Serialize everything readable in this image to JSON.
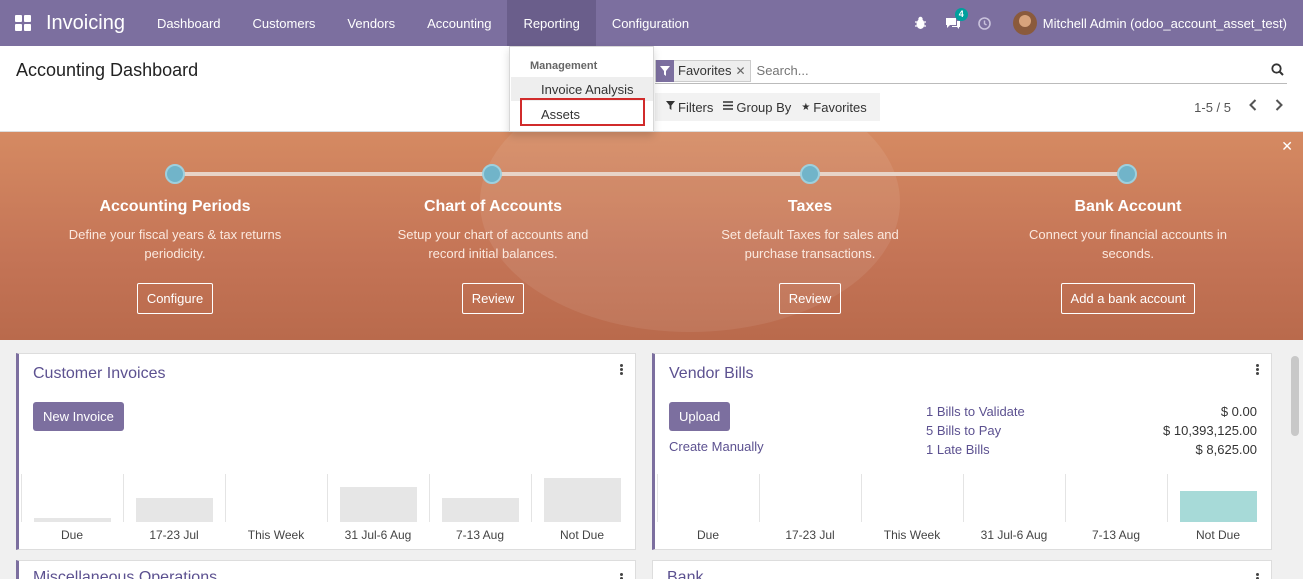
{
  "app": {
    "title": "Invoicing"
  },
  "nav": {
    "items": [
      {
        "label": "Dashboard"
      },
      {
        "label": "Customers"
      },
      {
        "label": "Vendors"
      },
      {
        "label": "Accounting"
      },
      {
        "label": "Reporting"
      },
      {
        "label": "Configuration"
      }
    ],
    "active": "Reporting",
    "chat_badge": "4",
    "user": "Mitchell Admin (odoo_account_asset_test)",
    "icons": [
      "bug-icon",
      "chat-icon",
      "clock-icon"
    ]
  },
  "control": {
    "title": "Accounting Dashboard",
    "facet_label": "Favorites",
    "search_placeholder": "Search...",
    "filters_label": "Filters",
    "groupby_label": "Group By",
    "favorites_label": "Favorites",
    "pager": "1-5 / 5"
  },
  "dropdown": {
    "header": "Management",
    "items": [
      {
        "label": "Invoice Analysis"
      },
      {
        "label": "Assets"
      }
    ],
    "highlighted": "Assets"
  },
  "banner": {
    "steps": [
      {
        "title": "Accounting Periods",
        "desc": "Define your fiscal years & tax returns periodicity.",
        "button": "Configure"
      },
      {
        "title": "Chart of Accounts",
        "desc": "Setup your chart of accounts and record initial balances.",
        "button": "Review"
      },
      {
        "title": "Taxes",
        "desc": "Set default Taxes for sales and purchase transactions.",
        "button": "Review"
      },
      {
        "title": "Bank Account",
        "desc": "Connect your financial accounts in seconds.",
        "button": "Add a bank account"
      }
    ]
  },
  "cards": {
    "customer_invoices": {
      "title": "Customer Invoices",
      "primary_button": "New Invoice",
      "chart_labels": [
        "Due",
        "17-23 Jul",
        "This Week",
        "31 Jul-6 Aug",
        "7-13 Aug",
        "Not Due"
      ],
      "chart_values": [
        0.08,
        0.5,
        0,
        0.72,
        0.5,
        0.92
      ]
    },
    "vendor_bills": {
      "title": "Vendor Bills",
      "primary_button": "Upload",
      "secondary_link": "Create Manually",
      "stats": [
        {
          "label": "1 Bills to Validate",
          "value": "$ 0.00"
        },
        {
          "label": "5 Bills to Pay",
          "value": "$ 10,393,125.00"
        },
        {
          "label": "1 Late Bills",
          "value": "$ 8,625.00"
        }
      ],
      "chart_labels": [
        "Due",
        "17-23 Jul",
        "This Week",
        "31 Jul-6 Aug",
        "7-13 Aug",
        "Not Due"
      ],
      "chart_values": [
        0,
        0,
        0,
        0,
        0,
        0.65
      ]
    },
    "misc": {
      "title": "Miscellaneous Operations"
    },
    "bank": {
      "title": "Bank"
    }
  },
  "colors": {
    "navbar": "#7c6f9f",
    "primary": "#7c6f9f",
    "link": "#5c5190",
    "chart_bar_customer": "#e6e6e6",
    "chart_bar_vendor": "#a7dad8",
    "dropdown_highlight": "#d12b2b"
  }
}
